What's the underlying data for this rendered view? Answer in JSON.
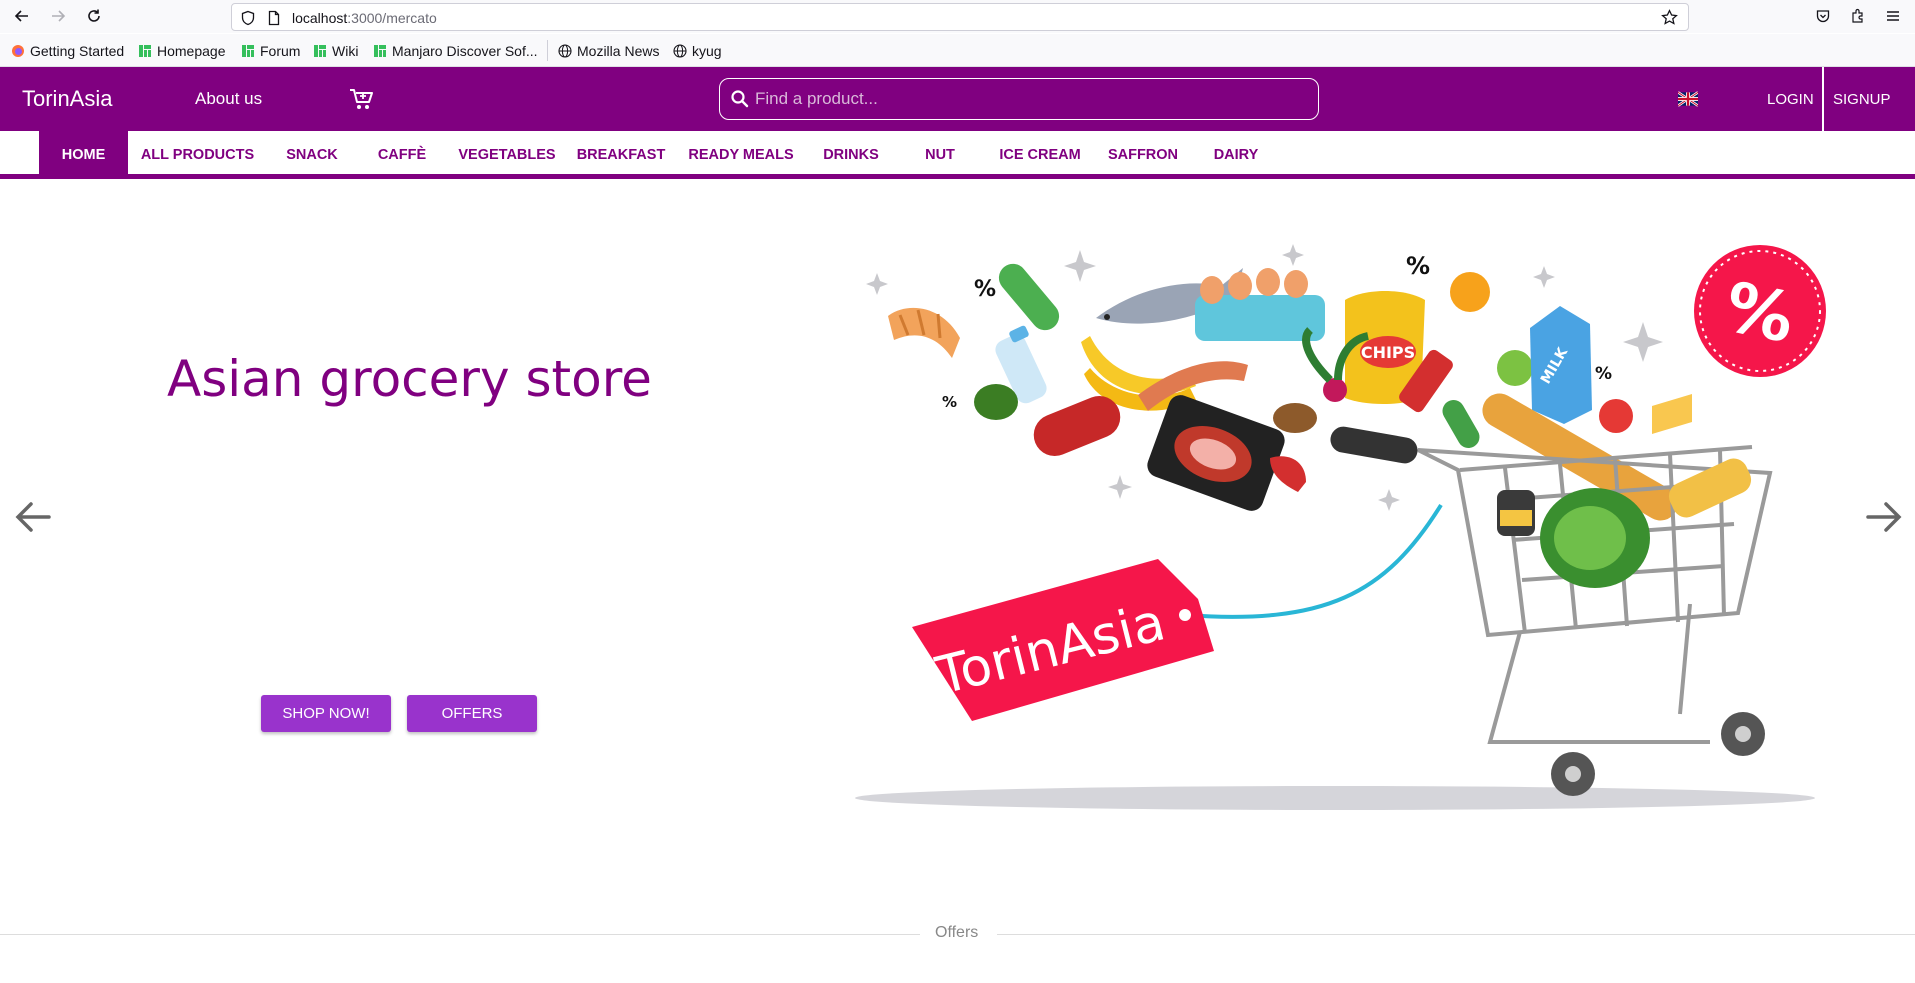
{
  "browser": {
    "url_host": "localhost",
    "url_path": ":3000/mercato",
    "bookmarks": [
      {
        "label": "Getting Started",
        "icon": "firefox-icon"
      },
      {
        "label": "Homepage",
        "icon": "manjaro-icon"
      },
      {
        "label": "Forum",
        "icon": "manjaro-icon"
      },
      {
        "label": "Wiki",
        "icon": "manjaro-icon"
      },
      {
        "label": "Manjaro Discover Sof...",
        "icon": "manjaro-icon"
      },
      {
        "label": "Mozilla News",
        "icon": "globe-icon"
      },
      {
        "label": "kyug",
        "icon": "globe-icon"
      }
    ]
  },
  "header": {
    "brand": "TorinAsia",
    "about": "About us",
    "search_placeholder": "Find a product...",
    "login": "LOGIN",
    "signup": "SIGNUP",
    "accent_color": "#800080"
  },
  "categories": [
    {
      "label": "HOME",
      "active": true
    },
    {
      "label": "ALL PRODUCTS"
    },
    {
      "label": "SNACK"
    },
    {
      "label": "CAFFÈ"
    },
    {
      "label": "VEGETABLES"
    },
    {
      "label": "BREAKFAST"
    },
    {
      "label": "READY MEALS"
    },
    {
      "label": "DRINKS"
    },
    {
      "label": "NUT"
    },
    {
      "label": "ICE CREAM"
    },
    {
      "label": "SAFFRON"
    },
    {
      "label": "DAIRY"
    }
  ],
  "hero": {
    "title": "Asian grocery store",
    "shop_now": "SHOP NOW!",
    "offers": "OFFERS",
    "tag_text": "TorinAsia",
    "chips_text": "CHIPS",
    "milk_text": "MILK",
    "discount_symbol": "%",
    "button_color": "#9933cc",
    "tag_color": "#f5164a"
  },
  "section": {
    "offers_label": "Offers"
  }
}
